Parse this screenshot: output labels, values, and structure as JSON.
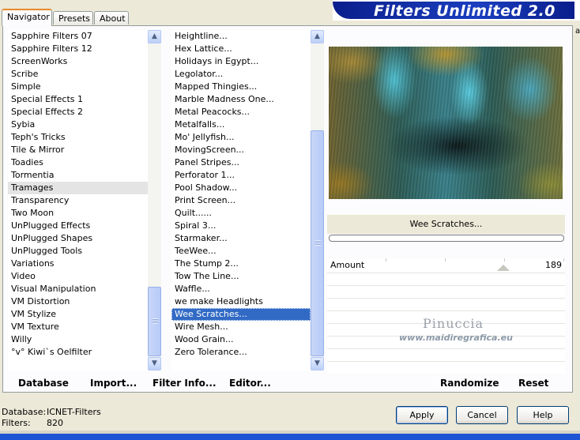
{
  "tabs": [
    "Navigator",
    "Presets",
    "About"
  ],
  "app_title": "Filters Unlimited 2.0",
  "right_edge_text": "a",
  "category_list": {
    "items": [
      "Sapphire Filters 07",
      "Sapphire Filters 12",
      "ScreenWorks",
      "Scribe",
      "Simple",
      "Special Effects 1",
      "Special Effects 2",
      "Sybia",
      "Teph's Tricks",
      "Tile & Mirror",
      "Toadies",
      "Tormentia",
      "Tramages",
      "Transparency",
      "Two Moon",
      "UnPlugged Effects",
      "UnPlugged Shapes",
      "UnPlugged Tools",
      "Variations",
      "Video",
      "Visual Manipulation",
      "VM Distortion",
      "VM Stylize",
      "VM Texture",
      "Willy",
      "°v° Kiwi`s Oelfilter"
    ],
    "highlighted": "Tramages"
  },
  "filter_list": {
    "items": [
      "Heightline...",
      "Hex Lattice...",
      "Holidays in Egypt...",
      "Legolator...",
      "Mapped Thingies...",
      "Marble Madness One...",
      "Metal Peacocks...",
      "Metalfalls...",
      "Mo' Jellyfish...",
      "MovingScreen...",
      "Panel Stripes...",
      "Perforator 1...",
      "Pool Shadow...",
      "Print Screen...",
      "Quilt......",
      "Spiral 3...",
      "Starmaker...",
      "TeeWee...",
      "The Stump 2...",
      "Tow The Line...",
      "Waffle...",
      "we make Headlights",
      "Wee Scratches...",
      "Wire Mesh...",
      "Wood Grain...",
      "Zero Tolerance..."
    ],
    "selected": "Wee Scratches..."
  },
  "preview": {
    "filter_name": "Wee Scratches...",
    "progress": 0
  },
  "params": [
    {
      "label": "Amount",
      "value": "189",
      "fraction": 0.741
    }
  ],
  "watermark": {
    "name": "Pinuccia",
    "url": "www.maidiregrafica.eu"
  },
  "left_buttons": {
    "database": "Database",
    "import": "Import...",
    "filter_info": "Filter Info...",
    "editor": "Editor..."
  },
  "right_buttons": {
    "randomize": "Randomize",
    "reset": "Reset"
  },
  "footer": {
    "database_label": "Database:",
    "database_value": "ICNET-Filters",
    "filters_label": "Filters:",
    "filters_value": "820"
  },
  "dialog_buttons": {
    "apply": "Apply",
    "cancel": "Cancel",
    "help": "Help"
  },
  "colors": {
    "selection": "#316ac5",
    "title_banner": "#0a1e8c",
    "window_bg": "#ece9d8"
  }
}
